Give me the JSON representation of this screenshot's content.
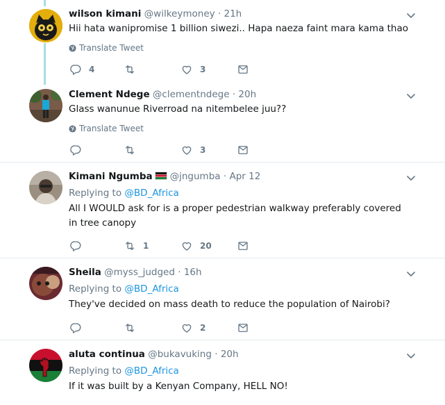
{
  "colors": {
    "accent": "#1b95e0",
    "muted": "#657786",
    "thread": "#a8dbea"
  },
  "tweets": [
    {
      "name": "wilson kimani",
      "handle": "@wilkeymoney",
      "dot": "·",
      "time": "21h",
      "text": "Hii hata wanipromise 1 billion siwezi.. Hapa naeza faint mara kama thao",
      "translate": "Translate Tweet",
      "reply_count": "4",
      "retweet_count": "",
      "like_count": "3"
    },
    {
      "name": "Clement Ndege",
      "handle": "@clementndege",
      "dot": "·",
      "time": "20h",
      "text": "Glass wanunue Riverroad na nitembelee juu??",
      "translate": "Translate Tweet",
      "reply_count": "",
      "retweet_count": "",
      "like_count": "3"
    },
    {
      "name": "Kimani Ngumba",
      "flag": "kenya-flag",
      "handle": "@jngumba",
      "dot": "·",
      "time": "Apr 12",
      "replying_prefix": "Replying to",
      "replying_to": "@BD_Africa",
      "text": "All I WOULD ask for is a proper pedestrian walkway preferably covered in tree canopy",
      "reply_count": "",
      "retweet_count": "1",
      "like_count": "20"
    },
    {
      "name": "Sheila",
      "handle": "@myss_judged",
      "dot": "·",
      "time": "16h",
      "replying_prefix": "Replying to",
      "replying_to": "@BD_Africa",
      "text": "They've decided on mass death to reduce the population of Nairobi?",
      "reply_count": "",
      "retweet_count": "",
      "like_count": "2"
    },
    {
      "name": "aluta continua",
      "handle": "@bukavuking",
      "dot": "·",
      "time": "20h",
      "replying_prefix": "Replying to",
      "replying_to": "@BD_Africa",
      "text": "If it was built by a Kenyan Company, HELL NO!"
    }
  ]
}
